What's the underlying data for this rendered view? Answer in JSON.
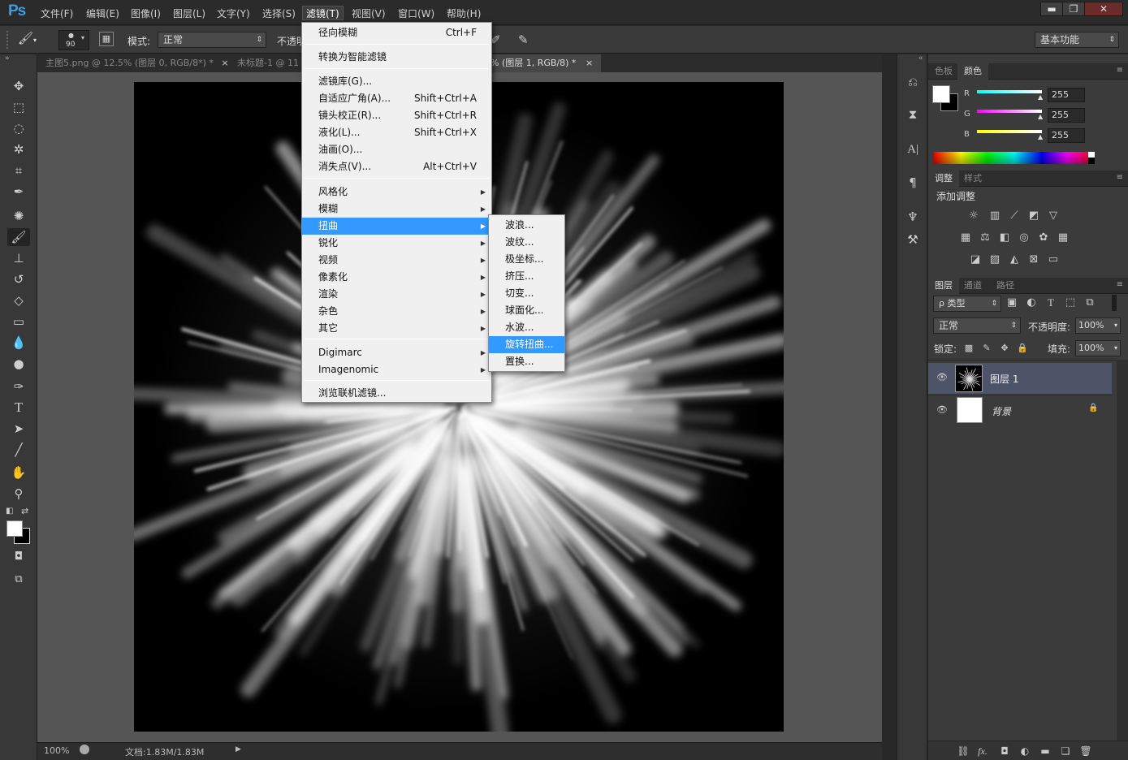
{
  "app": {
    "logo": "Ps"
  },
  "menubar": {
    "items": [
      "文件(F)",
      "编辑(E)",
      "图像(I)",
      "图层(L)",
      "文字(Y)",
      "选择(S)",
      "滤镜(T)",
      "视图(V)",
      "窗口(W)",
      "帮助(H)"
    ],
    "active": "滤镜(T)"
  },
  "window_controls": {
    "minimize": "▬",
    "maximize": "❐",
    "close": "✕"
  },
  "options": {
    "brush_size": "90",
    "mode_label": "模式:",
    "mode_value": "正常",
    "opacity_label": "不透明",
    "workspace": "基本功能"
  },
  "tabs": [
    {
      "label": "主图5.png @ 12.5% (图层 0, RGB/8*) *",
      "close": "×"
    },
    {
      "label": "未标题-1 @ 11",
      "close": ""
    },
    {
      "label": "% (图层 1, RGB/8) *",
      "close": "×"
    }
  ],
  "status": {
    "zoom": "100%",
    "doc": "文档:1.83M/1.83M"
  },
  "filter_menu": {
    "items": [
      {
        "label": "径向模糊",
        "shortcut": "Ctrl+F",
        "submenu": false
      },
      {
        "label": "转换为智能滤镜",
        "shortcut": "",
        "submenu": false
      },
      {
        "label": "滤镜库(G)...",
        "shortcut": "",
        "submenu": false
      },
      {
        "label": "自适应广角(A)...",
        "shortcut": "Shift+Ctrl+A",
        "submenu": false
      },
      {
        "label": "镜头校正(R)...",
        "shortcut": "Shift+Ctrl+R",
        "submenu": false
      },
      {
        "label": "液化(L)...",
        "shortcut": "Shift+Ctrl+X",
        "submenu": false
      },
      {
        "label": "油画(O)...",
        "shortcut": "",
        "submenu": false
      },
      {
        "label": "消失点(V)...",
        "shortcut": "Alt+Ctrl+V",
        "submenu": false
      },
      {
        "label": "风格化",
        "shortcut": "",
        "submenu": true
      },
      {
        "label": "模糊",
        "shortcut": "",
        "submenu": true
      },
      {
        "label": "扭曲",
        "shortcut": "",
        "submenu": true,
        "highlighted": true
      },
      {
        "label": "锐化",
        "shortcut": "",
        "submenu": true
      },
      {
        "label": "视频",
        "shortcut": "",
        "submenu": true
      },
      {
        "label": "像素化",
        "shortcut": "",
        "submenu": true
      },
      {
        "label": "渲染",
        "shortcut": "",
        "submenu": true
      },
      {
        "label": "杂色",
        "shortcut": "",
        "submenu": true
      },
      {
        "label": "其它",
        "shortcut": "",
        "submenu": true
      },
      {
        "label": "Digimarc",
        "shortcut": "",
        "submenu": true
      },
      {
        "label": "Imagenomic",
        "shortcut": "",
        "submenu": true
      },
      {
        "label": "浏览联机滤镜...",
        "shortcut": "",
        "submenu": false
      }
    ],
    "submenu_arrow": "▶"
  },
  "distort_submenu": {
    "items": [
      "波浪...",
      "波纹...",
      "极坐标...",
      "挤压...",
      "切变...",
      "球面化...",
      "水波...",
      "旋转扭曲...",
      "置换..."
    ],
    "highlighted": "旋转扭曲..."
  },
  "color_panel": {
    "tabs": [
      "色板",
      "颜色"
    ],
    "active_tab": "颜色",
    "channels": [
      {
        "label": "R",
        "value": "255"
      },
      {
        "label": "G",
        "value": "255"
      },
      {
        "label": "B",
        "value": "255"
      }
    ]
  },
  "adjust_panel": {
    "tabs": [
      "调整",
      "样式"
    ],
    "active_tab": "调整",
    "title": "添加调整"
  },
  "layers_panel": {
    "tabs": [
      "图层",
      "通道",
      "路径"
    ],
    "active_tab": "图层",
    "filter_kind": "ρ 类型",
    "blend_mode": "正常",
    "opacity_label": "不透明度:",
    "opacity_value": "100%",
    "lock_label": "锁定:",
    "fill_label": "填充:",
    "fill_value": "100%",
    "layers": [
      {
        "name": "图层 1",
        "visible": true,
        "selected": true
      },
      {
        "name": "背景",
        "visible": true,
        "selected": false,
        "locked": true
      }
    ],
    "footer_icons": [
      "link-icon",
      "fx-icon",
      "mask-icon",
      "adjustment-icon",
      "folder-icon",
      "new-layer-icon",
      "trash-icon"
    ]
  },
  "colors": {
    "accent": "#3399ff",
    "fg": "#ffffff",
    "bg": "#000000"
  }
}
